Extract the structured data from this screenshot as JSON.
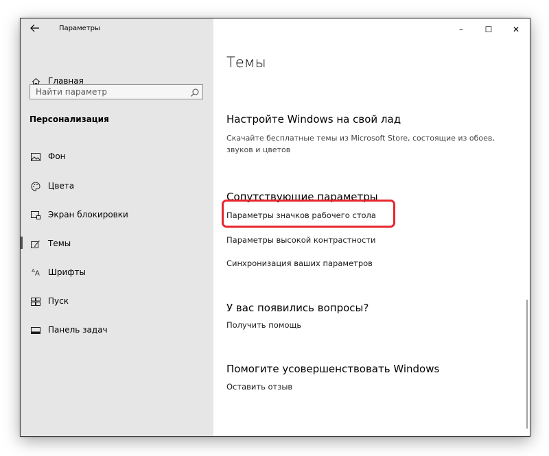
{
  "window": {
    "title": "Параметры",
    "controls": {
      "minimize": "–",
      "maximize": "☐",
      "close": "✕"
    }
  },
  "sidebar": {
    "home_label": "Главная",
    "search_placeholder": "Найти параметр",
    "section_title": "Персонализация",
    "items": [
      {
        "label": "Фон",
        "icon": "picture-icon"
      },
      {
        "label": "Цвета",
        "icon": "palette-icon"
      },
      {
        "label": "Экран блокировки",
        "icon": "lock-screen-icon"
      },
      {
        "label": "Темы",
        "icon": "themes-icon",
        "active": true
      },
      {
        "label": "Шрифты",
        "icon": "fonts-icon"
      },
      {
        "label": "Пуск",
        "icon": "start-icon"
      },
      {
        "label": "Панель задач",
        "icon": "taskbar-icon"
      }
    ]
  },
  "main": {
    "page_title": "Темы",
    "customize": {
      "heading": "Настройте Windows на свой лад",
      "description": "Скачайте бесплатные темы из Microsoft Store, состоящие из обоев, звуков и цветов"
    },
    "related": {
      "heading": "Сопутствующие параметры",
      "links": [
        "Параметры значков рабочего стола",
        "Параметры высокой контрастности",
        "Синхронизация ваших параметров"
      ]
    },
    "questions": {
      "heading": "У вас появились вопросы?",
      "link": "Получить помощь"
    },
    "improve": {
      "heading": "Помогите усовершенствовать Windows",
      "link": "Оставить отзыв"
    }
  },
  "colors": {
    "highlight": "#e8262e",
    "sidebar_bg": "#e6e6e6"
  }
}
